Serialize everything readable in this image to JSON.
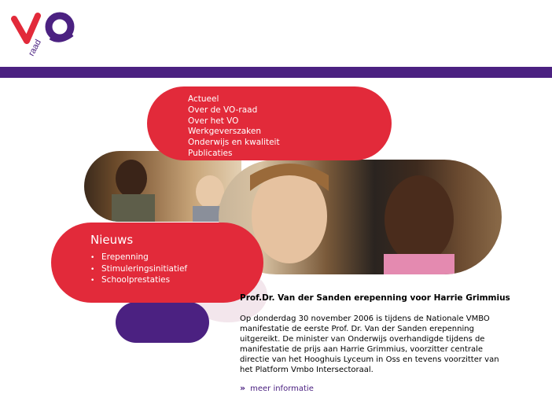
{
  "logo": {
    "letters": "VO",
    "sub": "raad"
  },
  "colors": {
    "red": "#e22a3a",
    "purple": "#4b2181",
    "white": "#ffffff"
  },
  "nav": {
    "items": [
      "Actueel",
      "Over de VO-raad",
      "Over het VO",
      "Werkgeverszaken",
      "Onderwijs en kwaliteit",
      "Publicaties"
    ]
  },
  "news": {
    "title": "Nieuws",
    "items": [
      "Erepenning",
      "Stimuleringsinitiatief",
      "Schoolprestaties"
    ]
  },
  "article": {
    "title": "Prof.Dr. Van der Sanden erepenning voor Harrie Grimmius",
    "body": "Op donderdag 30 november 2006 is tijdens de Nationale VMBO manifestatie de eerste Prof. Dr. Van der Sanden erepenning uitgereikt. De minister van Onderwijs overhandigde tijdens de manifestatie de prijs aan Harrie Grimmius, voorzitter centrale directie van het Hooghuis Lyceum in Oss en tevens voorzitter van het Platform Vmbo Intersectoraal.",
    "more_arrow": "»",
    "more_label": "meer informatie"
  }
}
